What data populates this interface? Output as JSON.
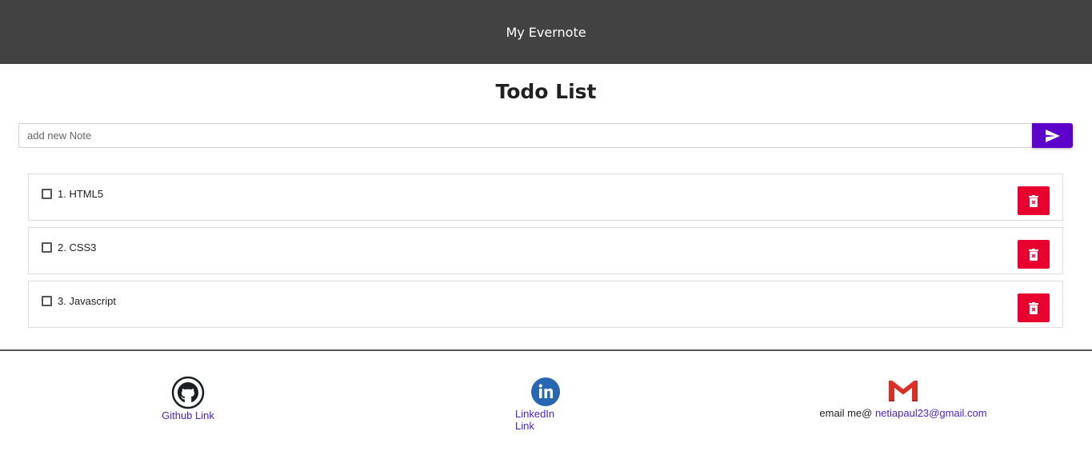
{
  "header": {
    "title": "My Evernote"
  },
  "main": {
    "title": "Todo List",
    "input": {
      "placeholder": "add new Note",
      "value": ""
    },
    "send_icon": "send-icon",
    "todos": [
      {
        "label": "1. HTML5",
        "checked": false
      },
      {
        "label": "2. CSS3",
        "checked": false
      },
      {
        "label": "3. Javascript",
        "checked": false
      }
    ]
  },
  "footer": {
    "github": {
      "icon": "github-icon",
      "label": "Github Link"
    },
    "linkedin": {
      "icon": "linkedin-icon",
      "label": "LinkedIn Link"
    },
    "email": {
      "icon": "gmail-icon",
      "prefix": "email me@ ",
      "address": "netiapaul23@gmail.com"
    }
  },
  "colors": {
    "header_bg": "#424242",
    "send_button": "#5d02c9",
    "delete_button": "#e8002f",
    "link": "#4a1fd0"
  }
}
